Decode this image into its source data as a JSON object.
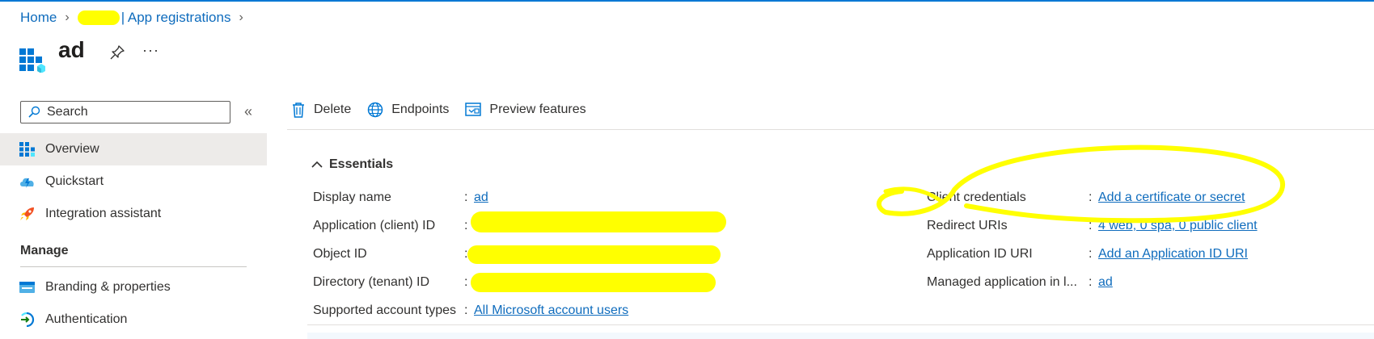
{
  "breadcrumb": {
    "home": "Home",
    "app_registrations": "| App registrations"
  },
  "app": {
    "name": "ad"
  },
  "header": {
    "more": "···"
  },
  "sidebar": {
    "search_placeholder": "Search",
    "collapse": "«",
    "items": [
      {
        "label": "Overview",
        "icon": "overview-grid-icon"
      },
      {
        "label": "Quickstart",
        "icon": "cloud-bolt-icon"
      },
      {
        "label": "Integration assistant",
        "icon": "rocket-icon"
      }
    ],
    "section_manage": "Manage",
    "manage_items": [
      {
        "label": "Branding & properties",
        "icon": "branding-card-icon"
      },
      {
        "label": "Authentication",
        "icon": "authentication-icon"
      }
    ]
  },
  "toolbar": {
    "delete": "Delete",
    "endpoints": "Endpoints",
    "preview": "Preview features"
  },
  "essentials": {
    "title": "Essentials",
    "left": {
      "display_name_label": "Display name",
      "display_name_value": "ad",
      "client_id_label": "Application (client) ID",
      "object_id_label": "Object ID",
      "tenant_id_label": "Directory (tenant) ID",
      "account_types_label": "Supported account types",
      "account_types_value": "All Microsoft account users"
    },
    "right": {
      "client_credentials_label": "Client credentials",
      "client_credentials_value": "Add a certificate or secret",
      "redirect_uris_label": "Redirect URIs",
      "redirect_uris_value": "4 web, 0 spa, 0 public client",
      "app_id_uri_label": "Application ID URI",
      "app_id_uri_value": "Add an Application ID URI",
      "managed_app_label": "Managed application in l...",
      "managed_app_value": "ad"
    },
    "colon": ":"
  },
  "colors": {
    "accent": "#0078d4",
    "link": "#0f6cbd",
    "redaction": "#ffff00",
    "selected_bg": "#edebe9"
  }
}
